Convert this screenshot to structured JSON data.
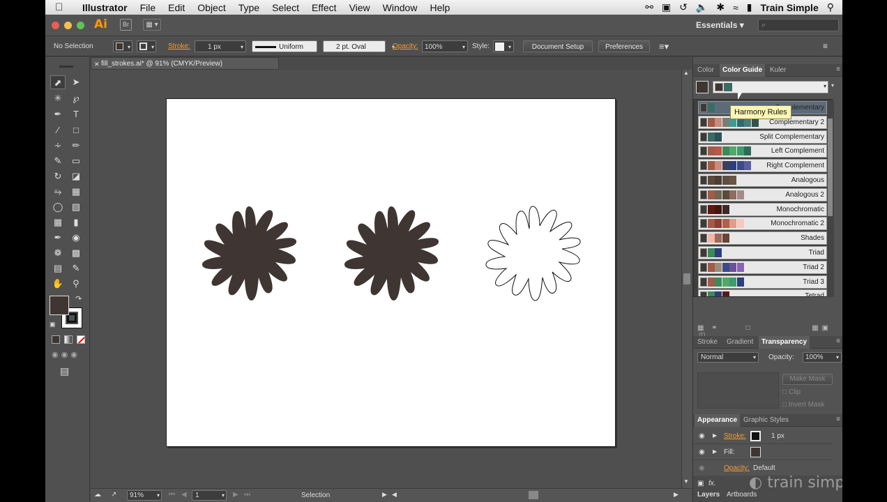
{
  "menubar": {
    "app": "Illustrator",
    "items": [
      "File",
      "Edit",
      "Object",
      "Type",
      "Select",
      "Effect",
      "View",
      "Window",
      "Help"
    ],
    "account": "Train Simple"
  },
  "appbar": {
    "logo": "Ai",
    "bridge": "Br",
    "workspace": "Essentials",
    "search_placeholder": "⌕"
  },
  "control": {
    "selection": "No Selection",
    "stroke_label": "Stroke:",
    "stroke_weight": "1 px",
    "profile": "Uniform",
    "brush": "2 pt. Oval",
    "opacity_label": "Opacity:",
    "opacity_value": "100%",
    "style_label": "Style:",
    "doc_setup": "Document Setup",
    "preferences": "Preferences"
  },
  "document": {
    "tab": "fill_strokes.ai* @ 91% (CMYK/Preview)",
    "zoom": "91%",
    "page": "1",
    "status": "Selection"
  },
  "colorguide": {
    "tabs": [
      "Color",
      "Color Guide",
      "Kuler"
    ],
    "tooltip": "Harmony Rules",
    "rules": [
      {
        "name": "Complementary",
        "colors": [
          "#3f3a36",
          "#3c6b63"
        ]
      },
      {
        "name": "Complementary 2",
        "colors": [
          "#3f3a36",
          "#a25b49",
          "#c98b7a",
          "#7d7b73",
          "#3e9c94",
          "#2c6b74",
          "#4a7c78",
          "#35524e"
        ]
      },
      {
        "name": "Split Complementary",
        "colors": [
          "#3f3a36",
          "#3c6b63",
          "#2b5258"
        ]
      },
      {
        "name": "Left Complement",
        "colors": [
          "#3f3a36",
          "#a25b49",
          "#b9574a",
          "#3c8a59",
          "#55a66b",
          "#3e9c6c",
          "#2f6c55"
        ]
      },
      {
        "name": "Right Complement",
        "colors": [
          "#3f3a36",
          "#a25b49",
          "#c98b7a",
          "#3d3f5c",
          "#2b3f7a",
          "#3c4a85",
          "#5a5fa2"
        ]
      },
      {
        "name": "Analogous",
        "colors": [
          "#3f3a36",
          "#5a4a3c",
          "#4a3d34",
          "#5b4f44",
          "#6a5445"
        ]
      },
      {
        "name": "Analogous 2",
        "colors": [
          "#3f3a36",
          "#a25b49",
          "#6e6552",
          "#5a4a3c",
          "#8c6d5f",
          "#a58b86"
        ]
      },
      {
        "name": "Monochromatic",
        "colors": [
          "#3f3a36",
          "#5a1a12",
          "#451511",
          "#3a2b24"
        ]
      },
      {
        "name": "Monochromatic 2",
        "colors": [
          "#3f3a36",
          "#a25b49",
          "#8c3e30",
          "#b55c4a",
          "#e59a8a",
          "#f5c9bf"
        ]
      },
      {
        "name": "Shades",
        "colors": [
          "#3f3a36",
          "#f1b7a8",
          "#9b6a5a",
          "#6a4436"
        ]
      },
      {
        "name": "Triad",
        "colors": [
          "#3f3a36",
          "#3c8a59",
          "#2b3f7a"
        ]
      },
      {
        "name": "Triad 2",
        "colors": [
          "#3f3a36",
          "#a25b49",
          "#9c8c7a",
          "#3c4a85",
          "#6c4f9a",
          "#8a63b0"
        ]
      },
      {
        "name": "Triad 3",
        "colors": [
          "#3f3a36",
          "#a25b49",
          "#3c8a59",
          "#55a66b",
          "#3e9c6c",
          "#2b3f7a"
        ]
      },
      {
        "name": "Tetrad",
        "colors": [
          "#3f3a36",
          "#3c8a59",
          "#2b3f7a",
          "#5a1a12"
        ]
      }
    ]
  },
  "transparency": {
    "tabs": [
      "Stroke",
      "Gradient",
      "Transparency"
    ],
    "blend": "Normal",
    "opacity_label": "Opacity:",
    "opacity_value": "100%",
    "make_mask": "Make Mask",
    "clip": "Clip",
    "invert": "Invert Mask"
  },
  "appearance": {
    "tabs": [
      "Appearance",
      "Graphic Styles"
    ],
    "stroke_label": "Stroke:",
    "stroke_value": "1 px",
    "fill_label": "Fill:",
    "opacity_label": "Opacity:",
    "opacity_value": "Default"
  },
  "bottom_tabs": [
    "Layers",
    "Artboards"
  ],
  "watermark": "train simple",
  "colors": {
    "flower_fill": "#3f3633",
    "accent": "#f39c34"
  }
}
